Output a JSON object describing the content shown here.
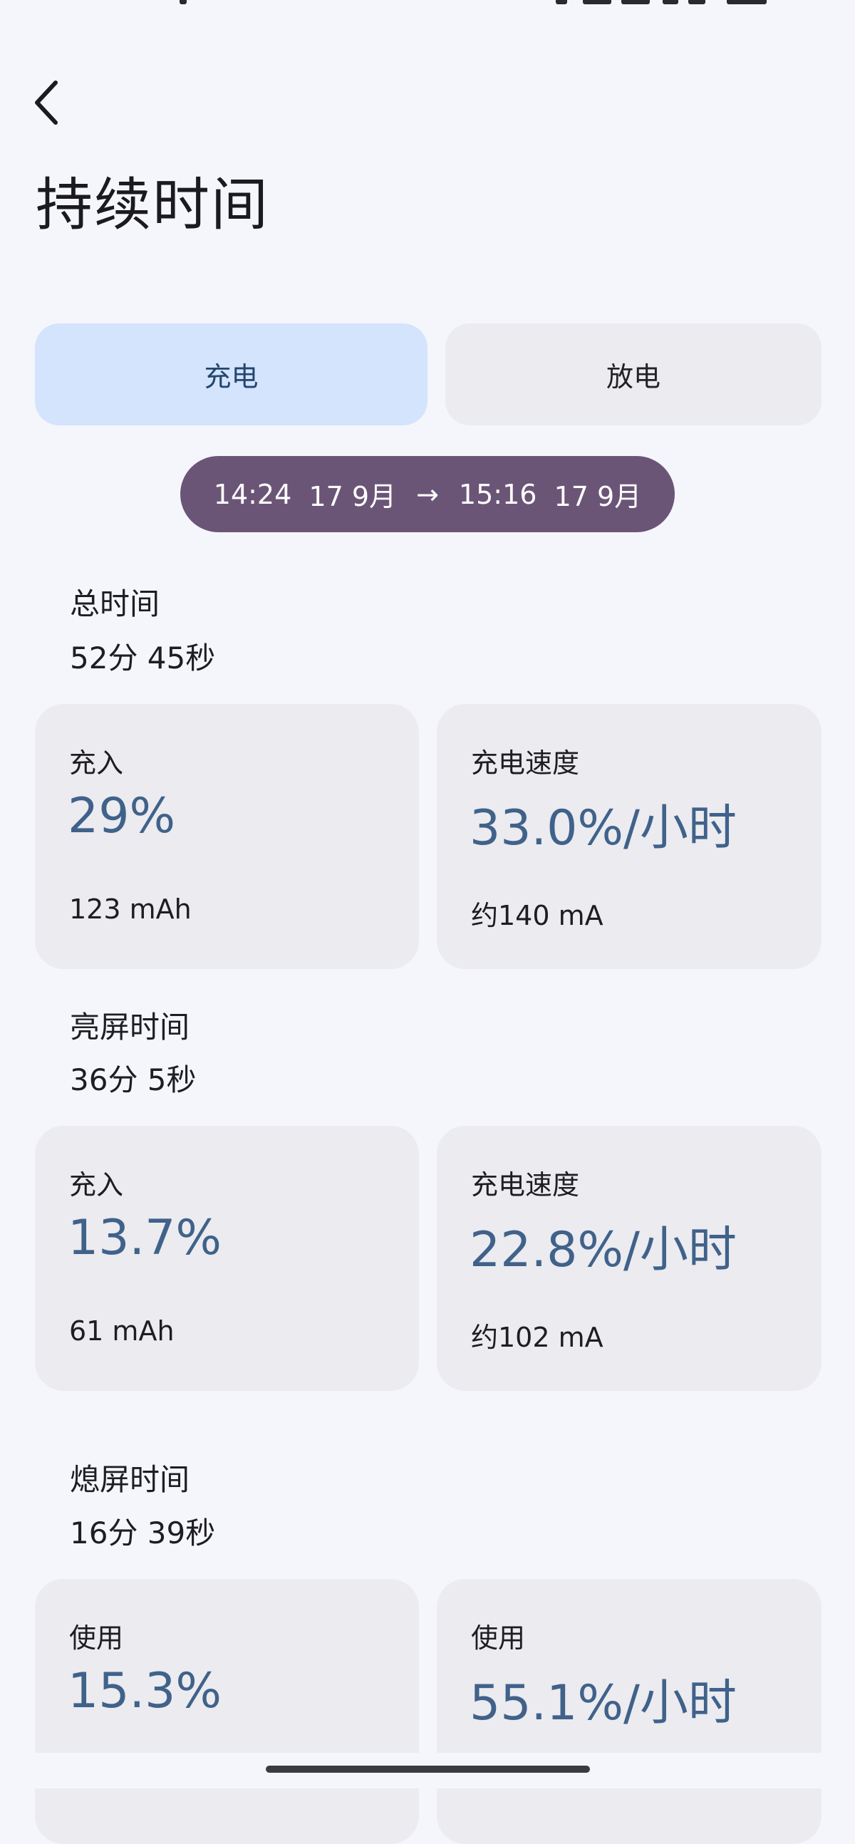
{
  "page": {
    "title": "持续时间",
    "back_icon": "chevron-left-icon"
  },
  "tabs": [
    {
      "label": "充电",
      "selected": true
    },
    {
      "label": "放电",
      "selected": false
    }
  ],
  "range": {
    "start_time": "14:24",
    "start_date": "17 9月",
    "arrow": "→",
    "end_time": "15:16",
    "end_date": "17 9月"
  },
  "sections": [
    {
      "title": "总时间",
      "value": "52分 45秒",
      "cards": [
        {
          "label": "充入",
          "value": "29%",
          "sub": "123 mAh"
        },
        {
          "label": "充电速度",
          "value": "33.0%/小时",
          "sub": "约140 mA"
        }
      ]
    },
    {
      "title": "亮屏时间",
      "value": "36分 5秒",
      "cards": [
        {
          "label": "充入",
          "value": "13.7%",
          "sub": "61 mAh"
        },
        {
          "label": "充电速度",
          "value": "22.8%/小时",
          "sub": "约102 mA"
        }
      ]
    },
    {
      "title": "熄屏时间",
      "value": "16分 39秒",
      "cards": [
        {
          "label": "使用",
          "value": "15.3%",
          "sub": ""
        },
        {
          "label": "使用",
          "value": "55.1%/小时",
          "sub": ""
        }
      ]
    }
  ],
  "colors": {
    "background": "#f5f6fb",
    "tab_selected": "#d3e4fc",
    "tab_unselected": "#ebebf0",
    "range_pill": "#6b5577",
    "card": "#ebebf0",
    "accent_value": "#40628a"
  }
}
